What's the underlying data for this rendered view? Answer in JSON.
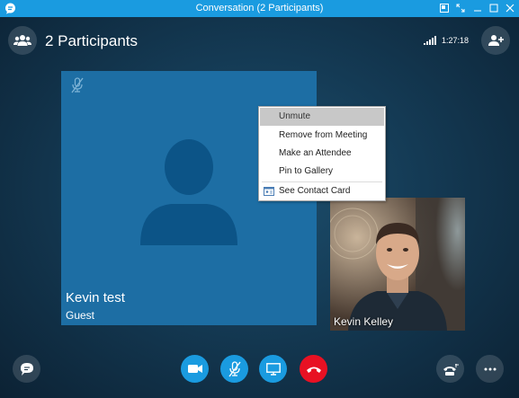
{
  "window": {
    "title": "Conversation (2 Participants)"
  },
  "header": {
    "participants_label": "2 Participants",
    "call_timer": "1:27:18"
  },
  "main_tile": {
    "name": "Kevin test",
    "role": "Guest",
    "background_color": "#1d6ea4"
  },
  "video_tile": {
    "name": "Kevin Kelley"
  },
  "context_menu": {
    "items": [
      {
        "label": "Unmute",
        "highlighted": true
      },
      {
        "label": "Remove from Meeting"
      },
      {
        "label": "Make an Attendee"
      },
      {
        "label": "Pin to Gallery"
      },
      {
        "label": "See Contact Card",
        "icon": "contact-card-icon"
      }
    ]
  },
  "controls": {
    "video": {
      "icon": "video-camera-icon",
      "color": "#1a9be0"
    },
    "mic": {
      "icon": "microphone-muted-icon",
      "color": "#1a9be0"
    },
    "screen": {
      "icon": "present-screen-icon",
      "color": "#1a9be0"
    },
    "hangup": {
      "icon": "hang-up-icon",
      "color": "#e81123"
    }
  },
  "colors": {
    "title_bar": "#1a9be0",
    "accent": "#1a9be0",
    "hangup": "#e81123"
  }
}
